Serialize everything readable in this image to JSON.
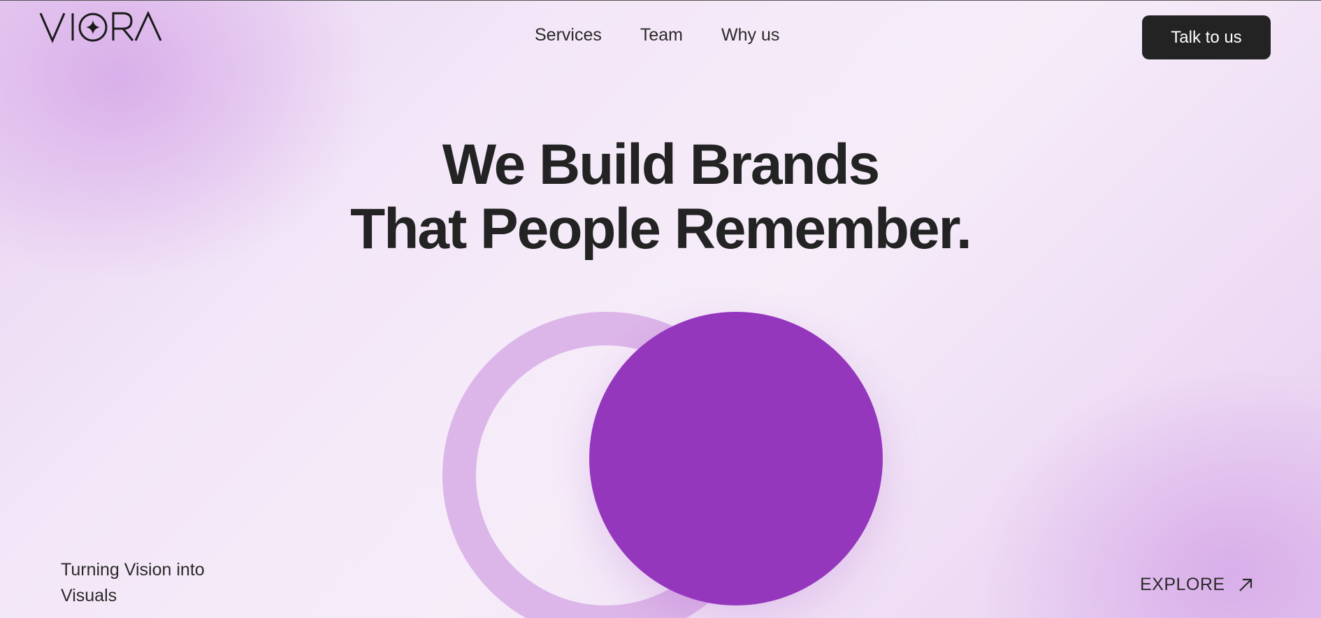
{
  "brand": {
    "logo_text": "VIORA",
    "logo_icon": "four-point-star-icon"
  },
  "nav": {
    "items": [
      {
        "label": "Services"
      },
      {
        "label": "Team"
      },
      {
        "label": "Why us"
      }
    ]
  },
  "header": {
    "cta_label": "Talk to us"
  },
  "hero": {
    "headline_line1": "We Build Brands",
    "headline_line2": "That People Remember."
  },
  "footer": {
    "tagline_line1": "Turning Vision into",
    "tagline_line2": "Visuals",
    "explore_label": "EXPLORE",
    "explore_icon": "arrow-up-right-icon"
  },
  "colors": {
    "accent": "#9437bd",
    "ring": "#ddb6e9",
    "button": "#232323",
    "text": "#232323"
  }
}
